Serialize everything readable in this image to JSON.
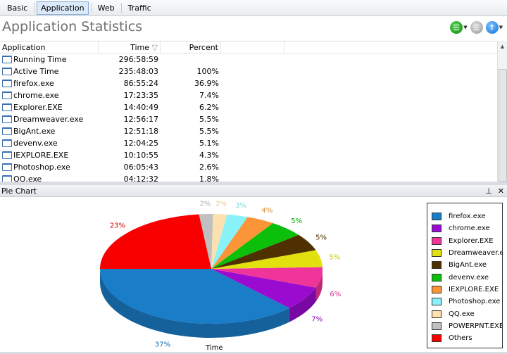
{
  "tabs": [
    "Basic",
    "Application",
    "Web",
    "Traffic"
  ],
  "active_tab": 1,
  "title": "Application Statistics",
  "toolbar_icons": [
    "list-green-icon",
    "list-gray-icon",
    "upload-blue-icon"
  ],
  "table": {
    "headers": [
      "Application",
      "Time",
      "Percent"
    ],
    "rows": [
      [
        "Running Time",
        "296:58:59",
        ""
      ],
      [
        "Active Time",
        "235:48:03",
        "100%"
      ],
      [
        "firefox.exe",
        "86:55:24",
        "36.9%"
      ],
      [
        "chrome.exe",
        "17:23:35",
        "7.4%"
      ],
      [
        "Explorer.EXE",
        "14:40:49",
        "6.2%"
      ],
      [
        "Dreamweaver.exe",
        "12:56:17",
        "5.5%"
      ],
      [
        "BigAnt.exe",
        "12:51:18",
        "5.5%"
      ],
      [
        "devenv.exe",
        "12:04:25",
        "5.1%"
      ],
      [
        "IEXPLORE.EXE",
        "10:10:55",
        "4.3%"
      ],
      [
        "Photoshop.exe",
        "06:05:43",
        "2.6%"
      ],
      [
        "QQ.exe",
        "04:12:32",
        "1.8%"
      ]
    ]
  },
  "pane_title": "Pie Chart",
  "chart_data": {
    "type": "pie",
    "xlabel": "Time",
    "legend": "right",
    "slices": [
      {
        "name": "firefox.exe",
        "value": 37,
        "label": "37%",
        "color": "#1a7dc8"
      },
      {
        "name": "chrome.exe",
        "value": 7,
        "label": "7%",
        "color": "#9a0bd0"
      },
      {
        "name": "Explorer.EXE",
        "value": 6,
        "label": "6%",
        "color": "#f0359a"
      },
      {
        "name": "Dreamweaver.exe",
        "value": 5,
        "label": "5%",
        "color": "#e3e010"
      },
      {
        "name": "BigAnt.exe",
        "value": 5,
        "label": "5%",
        "color": "#4f3000"
      },
      {
        "name": "devenv.exe",
        "value": 5,
        "label": "5%",
        "color": "#0bbf0b"
      },
      {
        "name": "IEXPLORE.EXE",
        "value": 4,
        "label": "4%",
        "color": "#fb9537"
      },
      {
        "name": "Photoshop.exe",
        "value": 3,
        "label": "3%",
        "color": "#88f2f8"
      },
      {
        "name": "QQ.exe",
        "value": 2,
        "label": "2%",
        "color": "#fde0b0"
      },
      {
        "name": "POWERPNT.EXE",
        "value": 2,
        "label": "2%",
        "color": "#c0c0c0"
      },
      {
        "name": "Others",
        "value": 23,
        "label": "23%",
        "color": "#f80000"
      }
    ]
  }
}
